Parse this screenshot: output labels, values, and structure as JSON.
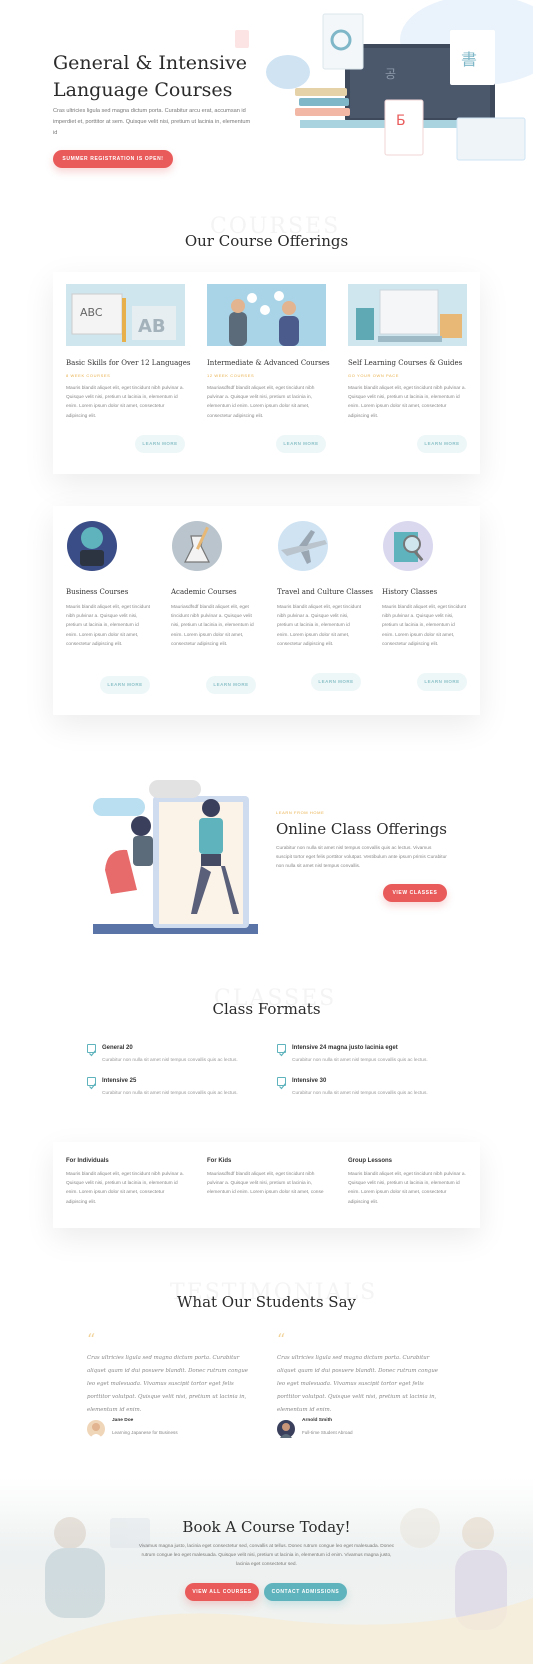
{
  "hero": {
    "title": "General & Intensive Language Courses",
    "description": "Cras ultricies ligula sed magna dictum porta. Curabitur arcu erat, accumsan id imperdiet et, porttitor at sem. Quisque velit nisi, pretium ut lacinia in, elementum id",
    "cta": "SUMMER REGISTRATION IS OPEN!"
  },
  "offerings": {
    "bg_word": "COURSES",
    "title": "Our Course Offerings",
    "cards": [
      {
        "title": "Basic Skills for Over 12 Languages",
        "sub": "8 WEEK COURSES",
        "text": "Mauris blandit aliquet elit, eget tincidunt nibh pulvinar a. Quisque velit nisi, pretium ut lacinia in, elementum id enim. Lorem ipsum dolor sit amet, consectetur adipiscing elit.",
        "btn": "LEARN MORE"
      },
      {
        "title": "Intermediate & Advanced Courses",
        "sub": "12 WEEK COURSES",
        "text": "Mauriasdfsdf blandit aliquet elit, eget tincidunt nibh pulvinar a. Quisque velit nisi, pretium ut lacinia in, elementum id enim. Lorem ipsum dolor sit amet, consectetur adipiscing elit.",
        "btn": "LEARN MORE"
      },
      {
        "title": "Self Learning Courses & Guides",
        "sub": "GO YOUR OWN PACE",
        "text": "Mauris blandit aliquet elit, eget tincidunt nibh pulvinar a. Quisque velit nisi, pretium ut lacinia in, elementum id enim. Lorem ipsum dolor sit amet, consectetur adipiscing elit.",
        "btn": "LEARN MORE"
      }
    ]
  },
  "topics": [
    {
      "title": "Business Courses",
      "text": "Mauris blandit aliquet elit, eget tincidunt nibh pulvinar a. Quisque velit nisi, pretium ut lacinia in, elementum id enim. Lorem ipsum dolor sit amet, consectetur adipiscing elit.",
      "btn": "LEARN MORE"
    },
    {
      "title": "Academic Courses",
      "text": "Mauriasdfsdf blandit aliquet elit, eget tincidunt nibh pulvinar a. Quisque velit nisi, pretium ut lacinia in, elementum id enim. Lorem ipsum dolor sit amet, consectetur adipiscing elit.",
      "btn": "LEARN MORE"
    },
    {
      "title": "Travel and Culture Classes",
      "text": "Mauris blandit aliquet elit, eget tincidunt nibh pulvinar a. Quisque velit nisi, pretium ut lacinia in, elementum id enim. Lorem ipsum dolor sit amet, consectetur adipiscing elit.",
      "btn": "LEARN MORE"
    },
    {
      "title": "History Classes",
      "text": "Mauris blandit aliquet elit, eget tincidunt nibh pulvinar a. Quisque velit nisi, pretium ut lacinia in, elementum id enim. Lorem ipsum dolor sit amet, consectetur adipiscing elit.",
      "btn": "LEARN MORE"
    }
  ],
  "online": {
    "eyebrow": "LEARN FROM HOME",
    "title": "Online Class Offerings",
    "text": "Curabitur non nulla sit amet nisl tempus convallis quis ac lectus. Vivamus suscipit tortor eget felis porttitor volutpat. Vestibulum ante ipsum primis Curabitur non nulla sit amet nisl tempus convallis.",
    "btn": "VIEW CLASSES"
  },
  "formats": {
    "bg_word": "CLASSES",
    "title": "Class Formats",
    "items": [
      {
        "title": "General 20",
        "text": "Curabitur non nulla sit amet nisl tempus convallis quis ac lectus."
      },
      {
        "title": "Intensive 24 magna justo lacinia eget",
        "text": "Curabitur non nulla sit amet nisl tempus convallis quis ac lectus."
      },
      {
        "title": "Intensive 25",
        "text": "Curabitur non nulla sit amet nisl tempus convallis quis ac lectus."
      },
      {
        "title": "Intensive 30",
        "text": "Curabitur non nulla sit amet nisl tempus convallis quis ac lectus."
      }
    ],
    "groups": [
      {
        "title": "For Individuals",
        "text": "Mauris blandit aliquet elit, eget tincidunt nibh pulvinar a. Quisque velit nisi, pretium ut lacinia in, elementum id enim. Lorem ipsum dolor sit amet, consectetur adipiscing elit."
      },
      {
        "title": "For Kids",
        "text": "Mauriasdfsdf blandit aliquet elit, eget tincidunt nibh pulvinar a. Quisque velit nisi, pretium ut lacinia in, elementum id enim. Lorem ipsum dolor sit amet, conse"
      },
      {
        "title": "Group Lessons",
        "text": "Mauris blandit aliquet elit, eget tincidunt nibh pulvinar a. Quisque velit nisi, pretium ut lacinia in, elementum id enim. Lorem ipsum dolor sit amet, consectetur adipiscing elit."
      }
    ]
  },
  "testimonials": {
    "bg_word": "TESTIMONIALS",
    "title": "What Our Students Say",
    "items": [
      {
        "quote": "Cras ultricies ligula sed magna dictum porta. Curabitur aliquet quam id dui posuere blandit. Donec rutrum congue leo eget malesuada. Vivamus suscipit tortor eget felis porttitor volutpat. Quisque velit nisi, pretium ut lacinia in, elementum id enim.",
        "name": "Jane Doe",
        "role": "Learning Japanese for Business"
      },
      {
        "quote": "Cras ultricies ligula sed magna dictum porta. Curabitur aliquet quam id dui posuere blandit. Donec rutrum congue leo eget malesuada. Vivamus suscipit tortor eget felis porttitor volutpat. Quisque velit nisi, pretium ut lacinia in, elementum id enim.",
        "name": "Arnold Smith",
        "role": "Full-time Student Abroad"
      }
    ]
  },
  "booking": {
    "title": "Book A Course Today!",
    "text": "Vivamus magna justo, lacinia eget consectetur sed, convallis at tellus. Donec rutrum congue leo eget malesuada. Donec rutrum congue leo eget malesuada. Quisque velit nisi, pretium ut lacinia in, elementum id enim. Vivamus magna justo, lacinia eget consectetur sed.",
    "btn_courses": "VIEW ALL COURSES",
    "btn_contact": "CONTACT ADMISSIONS"
  },
  "colors": {
    "accent_red": "#e95b5b",
    "accent_teal": "#5fb3bd",
    "gold": "#e8b04b"
  }
}
